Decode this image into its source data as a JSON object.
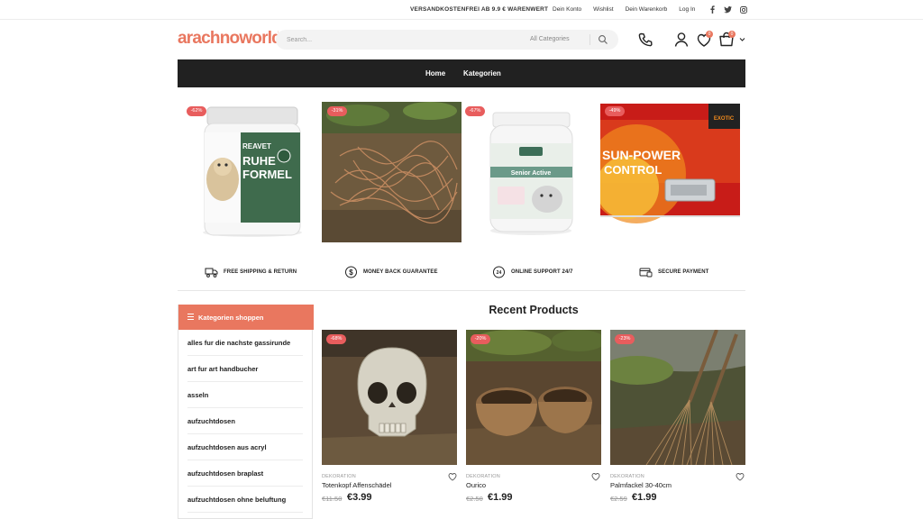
{
  "topbar": {
    "notice": "VERSANDKOSTENFREI AB 9.9 € WARENWERT",
    "links": [
      "Dein Konto",
      "Wishlist",
      "Dein Warenkorb",
      "Log In"
    ],
    "social_icons": [
      "facebook-icon",
      "twitter-icon",
      "instagram-icon"
    ]
  },
  "header": {
    "logo": "arachnoworld",
    "search_placeholder": "Search...",
    "search_category": "All Categories",
    "wishlist_count": "0",
    "cart_count": "0"
  },
  "nav": {
    "items": [
      "Home",
      "Kategorien"
    ]
  },
  "hero": [
    {
      "discount": "-62%"
    },
    {
      "discount": "-31%"
    },
    {
      "discount": "-67%"
    },
    {
      "discount": "-49%"
    }
  ],
  "hero_texts": {
    "label1": "REAVET",
    "label2": "RUHE",
    "label3": "FORMEL",
    "label4": "Senior Active",
    "label5": "SUN-POWER",
    "label6": "CONTROL",
    "label7": "EXOTIC"
  },
  "features": [
    {
      "icon": "truck-icon",
      "label": "FREE SHIPPING & RETURN"
    },
    {
      "icon": "money-icon",
      "label": "MONEY BACK GUARANTEE"
    },
    {
      "icon": "support-24-icon",
      "label": "ONLINE SUPPORT 24/7"
    },
    {
      "icon": "payment-icon",
      "label": "SECURE PAYMENT"
    }
  ],
  "sidebar": {
    "title": "Kategorien shoppen",
    "items": [
      "alles fur die nachste gassirunde",
      "art fur art handbucher",
      "asseln",
      "aufzuchtdosen",
      "aufzuchtdosen aus acryl",
      "aufzuchtdosen braplast",
      "aufzuchtdosen ohne beluftung"
    ]
  },
  "recent": {
    "title": "Recent Products",
    "products": [
      {
        "discount": "-68%",
        "category": "DEKORATION",
        "name": "Totenkopf Affenschädel",
        "old_price": "€11.50",
        "new_price": "€3.99"
      },
      {
        "discount": "-20%",
        "category": "DEKORATION",
        "name": "Ourico",
        "old_price": "€2.50",
        "new_price": "€1.99"
      },
      {
        "discount": "-23%",
        "category": "DEKORATION",
        "name": "Palmfackel 30-40cm",
        "old_price": "€2.59",
        "new_price": "€1.99"
      }
    ]
  },
  "colors": {
    "accent": "#e9775f",
    "nav_bg": "#212121",
    "discount": "#e85d5d"
  }
}
